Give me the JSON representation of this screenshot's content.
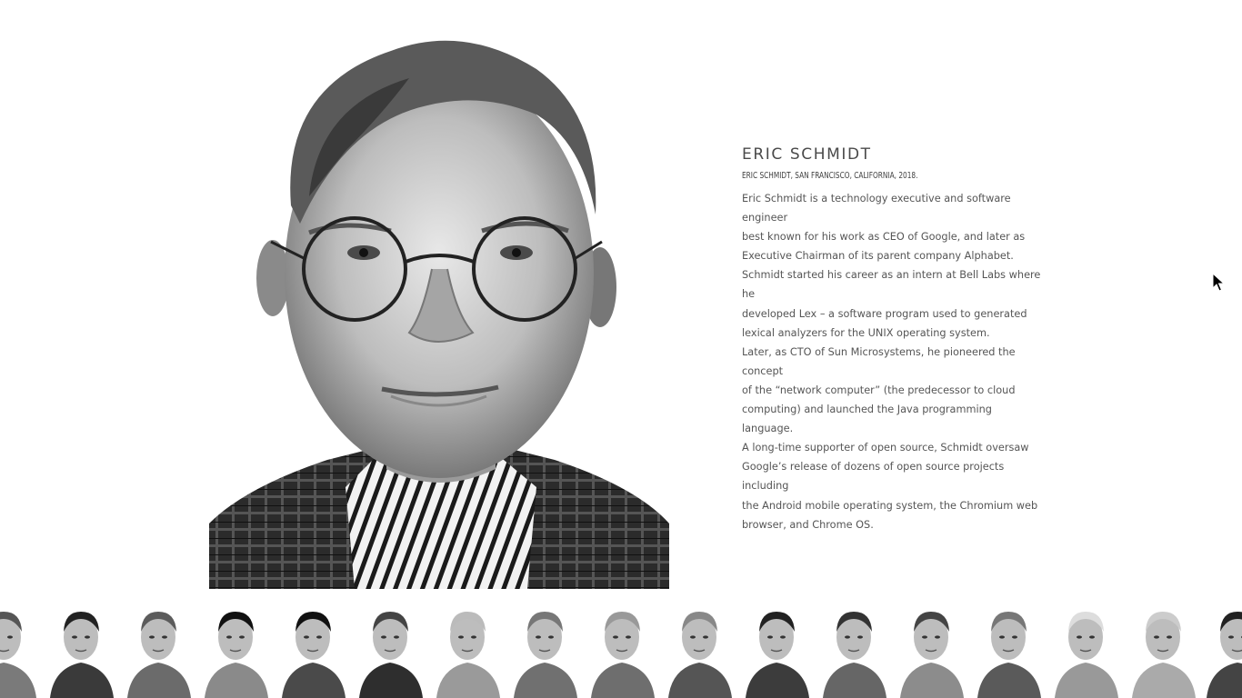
{
  "portrait": {
    "name": "ERIC SCHMIDT",
    "caption": "ERIC SCHMIDT, SAN FRANCISCO, CALIFORNIA, 2018.",
    "bio": "Eric Schmidt is a technology executive and software engineer\nbest known for his work as CEO of Google, and later as\nExecutive Chairman of its parent company Alphabet.\nSchmidt started his career as an intern at Bell Labs where he\ndeveloped Lex – a software program used to generated\nlexical analyzers for the UNIX operating system.\nLater, as CTO of Sun Microsystems, he pioneered the concept\nof the “network computer” (the predecessor to cloud\ncomputing) and launched the Java programming language.\nA long-time supporter of open source, Schmidt oversaw\nGoogle’s release of dozens of open source projects including\nthe Android mobile operating system, the Chromium web\nbrowser, and Chrome OS."
  },
  "thumbnails": [
    {
      "icon": "portrait-thumbnail",
      "selected": false
    },
    {
      "icon": "portrait-thumbnail",
      "selected": false
    },
    {
      "icon": "portrait-thumbnail",
      "selected": false
    },
    {
      "icon": "portrait-thumbnail",
      "selected": false
    },
    {
      "icon": "portrait-thumbnail",
      "selected": false
    },
    {
      "icon": "portrait-thumbnail",
      "selected": false
    },
    {
      "icon": "portrait-thumbnail",
      "selected": false
    },
    {
      "icon": "portrait-thumbnail",
      "selected": false
    },
    {
      "icon": "portrait-thumbnail",
      "selected": true
    },
    {
      "icon": "portrait-thumbnail",
      "selected": false
    },
    {
      "icon": "portrait-thumbnail",
      "selected": false
    },
    {
      "icon": "portrait-thumbnail",
      "selected": false
    },
    {
      "icon": "portrait-thumbnail",
      "selected": false
    },
    {
      "icon": "portrait-thumbnail",
      "selected": false
    },
    {
      "icon": "portrait-thumbnail",
      "selected": false
    },
    {
      "icon": "portrait-thumbnail",
      "selected": false
    },
    {
      "icon": "portrait-thumbnail",
      "selected": false
    }
  ],
  "colors": {
    "text": "#555555",
    "heading": "#4a4a4a",
    "background": "#ffffff"
  }
}
